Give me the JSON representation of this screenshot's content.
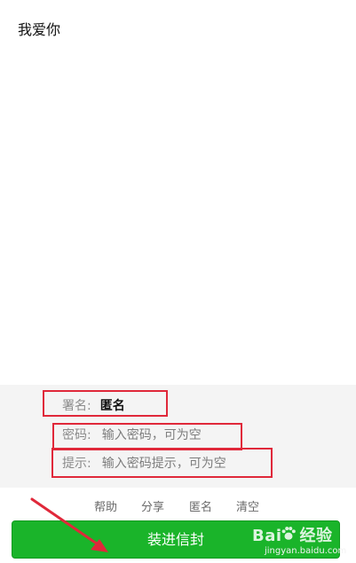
{
  "message": {
    "text": "我爱你"
  },
  "form": {
    "signature": {
      "label": "署名:",
      "value": "匿名"
    },
    "password": {
      "label": "密码:",
      "placeholder": "输入密码，可为空"
    },
    "hint": {
      "label": "提示:",
      "placeholder": "输入密码提示，可为空"
    }
  },
  "actions": {
    "help": "帮助",
    "share": "分享",
    "anonymous": "匿名",
    "clear": "清空"
  },
  "submit": {
    "label": "装进信封"
  },
  "watermark": {
    "logo_left": "Bai",
    "logo_right": "经验",
    "url": "jingyan.baidu.com"
  },
  "colors": {
    "accent": "#1ab42a",
    "annotation": "#e0283a"
  }
}
